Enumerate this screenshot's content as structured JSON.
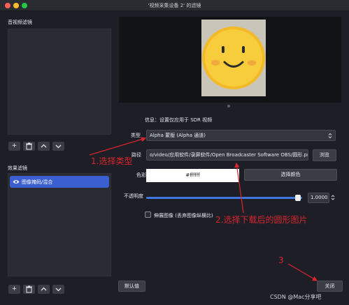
{
  "window": {
    "title": "'视频采集设备 2' 的滤镜",
    "traffic_lights": {
      "close": "#fe5f57",
      "minimize": "#febc2e",
      "zoom": "#28c840"
    }
  },
  "sidebar": {
    "audio_filters_label": "音视频滤镜",
    "effect_filters_label": "效果滤镜",
    "effect_filters": [
      {
        "label": "图像掩码/混合",
        "icon": "eye-icon",
        "selected": true
      }
    ],
    "toolbar_icons": {
      "add": "+",
      "remove": "trash-icon",
      "up": "chevron-up-icon",
      "down": "chevron-down-icon"
    }
  },
  "preview": {
    "background_color": "#121317",
    "dots_count": 3
  },
  "properties": {
    "info_text": "信息：设置仅应用于 SDR 视频",
    "type_label": "类型",
    "type_value": "Alpha 蒙版 (Alpha 通道)",
    "path_label": "路径",
    "path_value": "o/video/应用软件/录屏软件/Open Broadcaster Software OBS/圆形.png",
    "browse_button": "浏览",
    "color_label": "色彩",
    "color_value": "#ffffff",
    "choose_color_button": "选择颜色",
    "opacity_label": "不透明度",
    "opacity_value": "1.0000",
    "opacity_fraction": 1.0,
    "stretch_checkbox_label": "伸展图像 (丢弃图像纵横比)",
    "stretch_checked": false
  },
  "footer": {
    "defaults_button": "默认值",
    "close_button": "关闭"
  },
  "annotations": {
    "step1": "1.选择类型",
    "step2": "2.选择下载后的圆形图片",
    "step3": "3",
    "color": "#d8252e"
  },
  "watermark": "CSDN @Mac分享吧"
}
